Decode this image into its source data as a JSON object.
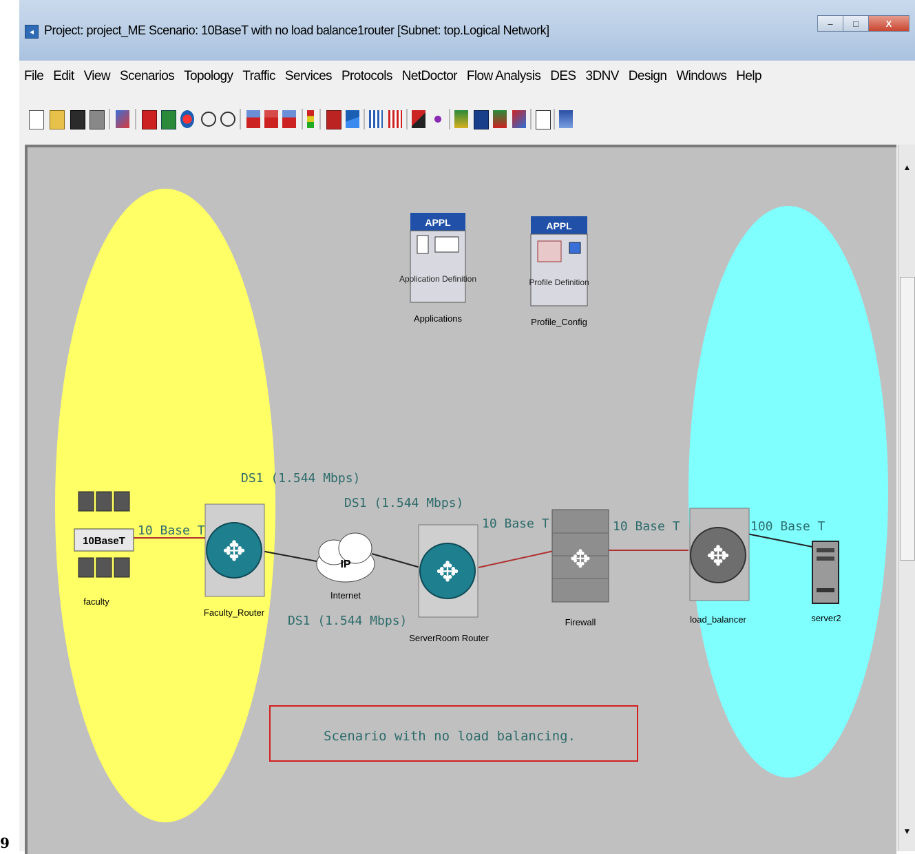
{
  "window": {
    "title": "Project: project_ME Scenario: 10BaseT with no load balance1router  [Subnet: top.Logical Network]",
    "controls": {
      "minimize": "–",
      "maximize": "□",
      "close": "X"
    }
  },
  "menubar": {
    "items": [
      "File",
      "Edit",
      "View",
      "Scenarios",
      "Topology",
      "Traffic",
      "Services",
      "Protocols",
      "NetDoctor",
      "Flow Analysis",
      "DES",
      "3DNV",
      "Design",
      "Windows",
      "Help"
    ]
  },
  "toolbar": {
    "icons": [
      "new-project-icon",
      "open-icon",
      "save-icon",
      "print-icon",
      "network-browser-icon",
      "open-palette-icon",
      "rapid-config-icon",
      "locate-icon",
      "zoom-in-icon",
      "zoom-out-icon",
      "import-traffic-1-icon",
      "import-traffic-2-icon",
      "import-traffic-3-icon",
      "fail-node-icon",
      "recover-node-icon",
      "edit-attributes-icon",
      "verify-links-icon",
      "merge-icon",
      "flow-analysis-icon",
      "configure-sim-icon",
      "run-sim-icon",
      "view-results-icon",
      "report-icon",
      "log-icon",
      "web-report-1-icon",
      "web-report-2-icon"
    ]
  },
  "canvas": {
    "colors": {
      "background": "#c0c0c0",
      "faculty_zone": "#ffff66",
      "server_zone": "#80ffff",
      "router": "#1e7f8f",
      "link_red": "#b03030"
    },
    "config_objects": [
      {
        "id": "applications",
        "header": "APPL",
        "inner_text": "Application Definition",
        "label": "Applications"
      },
      {
        "id": "profile",
        "header": "APPL",
        "inner_text": "Profile Definition",
        "label": "Profile_Config"
      }
    ],
    "nodes": {
      "faculty": {
        "label": "faculty",
        "badge": "10BaseT"
      },
      "faculty_router": {
        "label": "Faculty_Router"
      },
      "internet": {
        "label": "Internet",
        "badge": "IP"
      },
      "serverroom_router": {
        "label": "ServerRoom Router"
      },
      "firewall": {
        "label": "Firewall"
      },
      "load_balancer": {
        "label": "load_balancer"
      },
      "server2": {
        "label": "server2"
      }
    },
    "links": {
      "faculty_to_router": "10 Base T",
      "router_to_internet_top": "DS1 (1.544 Mbps)",
      "internet_to_serverroom": "DS1 (1.544 Mbps)",
      "router_to_internet_bottom": "DS1 (1.544 Mbps)",
      "serverroom_to_firewall": "10 Base T",
      "firewall_to_balancer": "10 Base T",
      "balancer_to_server": "100 Base T"
    },
    "annotation": "Scenario with no load balancing."
  },
  "page_number": "9"
}
